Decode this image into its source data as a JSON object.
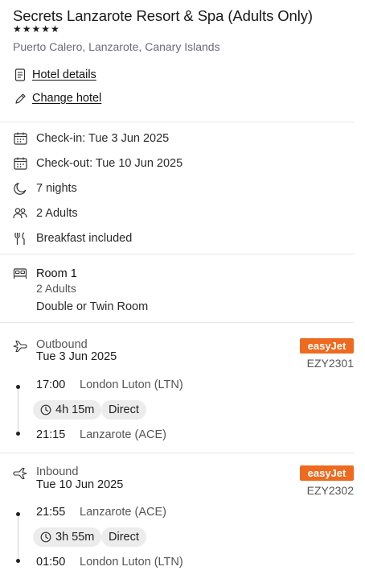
{
  "hotel": {
    "name": "Secrets Lanzarote Resort & Spa (Adults Only)",
    "stars": "★★★★★",
    "location": "Puerto Calero, Lanzarote, Canary Islands",
    "details_link": "Hotel details",
    "change_link": "Change hotel"
  },
  "stay": {
    "check_in": "Check-in: Tue 3 Jun 2025",
    "check_out": "Check-out: Tue 10 Jun 2025",
    "nights": "7 nights",
    "guests": "2 Adults",
    "board": "Breakfast included"
  },
  "room": {
    "title": "Room 1",
    "guests": "2 Adults",
    "type": "Double or Twin Room"
  },
  "outbound": {
    "label": "Outbound",
    "date": "Tue 3 Jun 2025",
    "airline": "easyJet",
    "flight_number": "EZY2301",
    "depart_time": "17:00",
    "depart_airport": "London Luton (LTN)",
    "duration": "4h 15m",
    "stops": "Direct",
    "arrive_time": "21:15",
    "arrive_airport": "Lanzarote (ACE)"
  },
  "inbound": {
    "label": "Inbound",
    "date": "Tue 10 Jun 2025",
    "airline": "easyJet",
    "flight_number": "EZY2302",
    "depart_time": "21:55",
    "depart_airport": "Lanzarote (ACE)",
    "duration": "3h 55m",
    "stops": "Direct",
    "arrive_time": "01:50",
    "arrive_airport": "London Luton (LTN)"
  },
  "colors": {
    "airline_brand": "#ee6a1f",
    "pill_bg": "#ececec"
  }
}
